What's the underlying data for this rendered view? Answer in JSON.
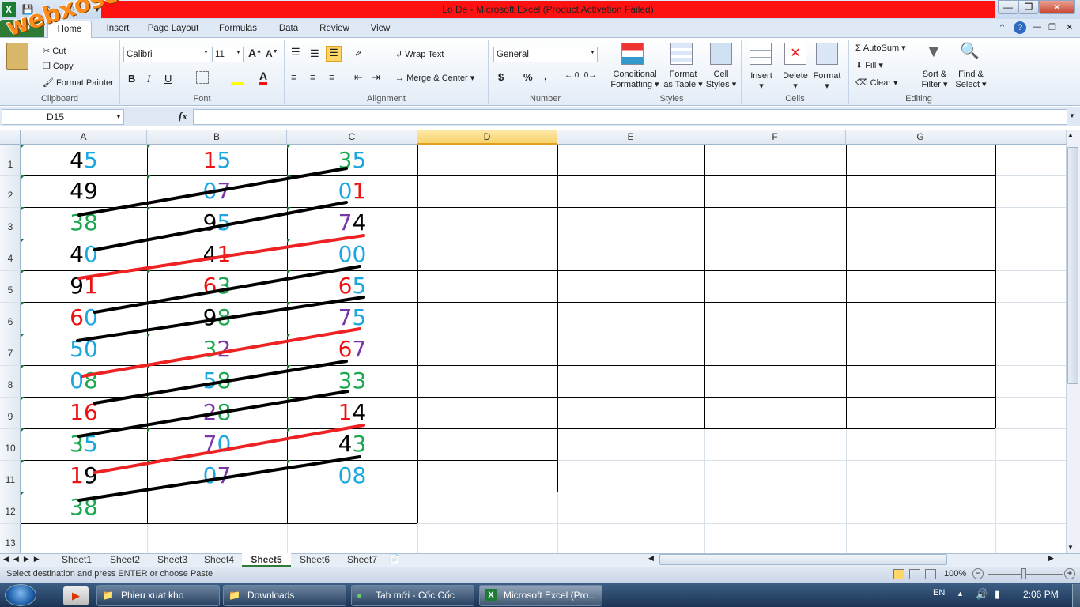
{
  "window": {
    "title": "Lo De  -  Microsoft Excel (Product Activation Failed)"
  },
  "tabs": [
    "File",
    "Home",
    "Insert",
    "Page Layout",
    "Formulas",
    "Data",
    "Review",
    "View"
  ],
  "ribbon": {
    "clipboard": {
      "label": "Clipboard",
      "cut": "Cut",
      "copy": "Copy",
      "format_painter": "Format Painter"
    },
    "font": {
      "label": "Font",
      "family": "Calibri",
      "size": "11"
    },
    "alignment": {
      "label": "Alignment",
      "wrap_text": "Wrap Text",
      "merge_center": "Merge & Center"
    },
    "number": {
      "label": "Number",
      "format": "General"
    },
    "styles": {
      "label": "Styles",
      "conditional": "Conditional",
      "conditional2": "Formatting",
      "format_table": "Format",
      "format_table2": "as Table",
      "cell_styles": "Cell",
      "cell_styles2": "Styles"
    },
    "cells": {
      "label": "Cells",
      "insert": "Insert",
      "delete": "Delete",
      "format": "Format"
    },
    "editing": {
      "label": "Editing",
      "autosum": "AutoSum",
      "fill": "Fill",
      "clear": "Clear",
      "sort": "Sort &",
      "sort2": "Filter",
      "find": "Find &",
      "find2": "Select"
    }
  },
  "formula_bar": {
    "name_box": "D15",
    "fx": "fx",
    "formula": ""
  },
  "columns": [
    "A",
    "B",
    "C",
    "D",
    "E",
    "F",
    "G"
  ],
  "rows": [
    "1",
    "2",
    "3",
    "4",
    "5",
    "6",
    "7",
    "8",
    "9",
    "10",
    "11",
    "12",
    "13"
  ],
  "cells": {
    "A": [
      [
        [
          "4",
          "#000"
        ],
        [
          "5",
          "#1aa7e0"
        ]
      ],
      [
        [
          "4",
          "#000"
        ],
        [
          "9",
          "#000"
        ]
      ],
      [
        [
          "3",
          "#1aa84f"
        ],
        [
          "8",
          "#1aa84f"
        ]
      ],
      [
        [
          "4",
          "#000"
        ],
        [
          "0",
          "#1aa7e0"
        ]
      ],
      [
        [
          "9",
          "#000"
        ],
        [
          "1",
          "#ee1111"
        ]
      ],
      [
        [
          "6",
          "#ee1111"
        ],
        [
          "0",
          "#1aa7e0"
        ]
      ],
      [
        [
          "5",
          "#1aa7e0"
        ],
        [
          "0",
          "#1aa7e0"
        ]
      ],
      [
        [
          "0",
          "#1aa7e0"
        ],
        [
          "8",
          "#1aa84f"
        ]
      ],
      [
        [
          "1",
          "#ee1111"
        ],
        [
          "6",
          "#ee1111"
        ]
      ],
      [
        [
          "3",
          "#1aa84f"
        ],
        [
          "5",
          "#1aa7e0"
        ]
      ],
      [
        [
          "1",
          "#ee1111"
        ],
        [
          "9",
          "#000"
        ]
      ],
      [
        [
          "3",
          "#1aa84f"
        ],
        [
          "8",
          "#1aa84f"
        ]
      ]
    ],
    "B": [
      [
        [
          "1",
          "#ee1111"
        ],
        [
          "5",
          "#1aa7e0"
        ]
      ],
      [
        [
          "0",
          "#1aa7e0"
        ],
        [
          "7",
          "#7a35a8"
        ]
      ],
      [
        [
          "9",
          "#000"
        ],
        [
          "5",
          "#1aa7e0"
        ]
      ],
      [
        [
          "4",
          "#000"
        ],
        [
          "1",
          "#ee1111"
        ]
      ],
      [
        [
          "6",
          "#ee1111"
        ],
        [
          "3",
          "#1aa84f"
        ]
      ],
      [
        [
          "9",
          "#000"
        ],
        [
          "8",
          "#1aa84f"
        ]
      ],
      [
        [
          "3",
          "#1aa84f"
        ],
        [
          "2",
          "#7a35a8"
        ]
      ],
      [
        [
          "5",
          "#1aa7e0"
        ],
        [
          "8",
          "#1aa84f"
        ]
      ],
      [
        [
          "2",
          "#7a35a8"
        ],
        [
          "8",
          "#1aa84f"
        ]
      ],
      [
        [
          "7",
          "#7a35a8"
        ],
        [
          "0",
          "#1aa7e0"
        ]
      ],
      [
        [
          "0",
          "#1aa7e0"
        ],
        [
          "7",
          "#7a35a8"
        ]
      ]
    ],
    "C": [
      [
        [
          "3",
          "#1aa84f"
        ],
        [
          "5",
          "#1aa7e0"
        ]
      ],
      [
        [
          "0",
          "#1aa7e0"
        ],
        [
          "1",
          "#ee1111"
        ]
      ],
      [
        [
          "7",
          "#7a35a8"
        ],
        [
          "4",
          "#000"
        ]
      ],
      [
        [
          "0",
          "#1aa7e0"
        ],
        [
          "0",
          "#1aa7e0"
        ]
      ],
      [
        [
          "6",
          "#ee1111"
        ],
        [
          "5",
          "#1aa7e0"
        ]
      ],
      [
        [
          "7",
          "#7a35a8"
        ],
        [
          "5",
          "#1aa7e0"
        ]
      ],
      [
        [
          "6",
          "#ee1111"
        ],
        [
          "7",
          "#7a35a8"
        ]
      ],
      [
        [
          "3",
          "#1aa84f"
        ],
        [
          "3",
          "#1aa84f"
        ]
      ],
      [
        [
          "1",
          "#ee1111"
        ],
        [
          "4",
          "#000"
        ]
      ],
      [
        [
          "4",
          "#000"
        ],
        [
          "3",
          "#1aa84f"
        ]
      ],
      [
        [
          "0",
          "#1aa7e0"
        ],
        [
          "8",
          "#1aa7e0"
        ]
      ]
    ]
  },
  "strokes": [
    {
      "color": "#000000"
    },
    {
      "color": "#000000"
    },
    {
      "color": "#ee2222"
    },
    {
      "color": "#000000"
    },
    {
      "color": "#000000"
    },
    {
      "color": "#ee2222"
    },
    {
      "color": "#000000"
    },
    {
      "color": "#000000"
    },
    {
      "color": "#ee2222"
    },
    {
      "color": "#000000"
    }
  ],
  "sheets": [
    "Sheet1",
    "Sheet2",
    "Sheet3",
    "Sheet4",
    "Sheet5",
    "Sheet6",
    "Sheet7"
  ],
  "active_sheet": "Sheet5",
  "status": {
    "message": "Select destination and press ENTER or choose Paste",
    "zoom": "100%"
  },
  "taskbar": {
    "items": [
      "Phieu xuat kho",
      "Downloads",
      "Tab mới - Cốc Cốc",
      "Microsoft Excel (Pro..."
    ],
    "lang": "EN",
    "clock": "2:06 PM"
  },
  "watermark": "webxoso.net"
}
